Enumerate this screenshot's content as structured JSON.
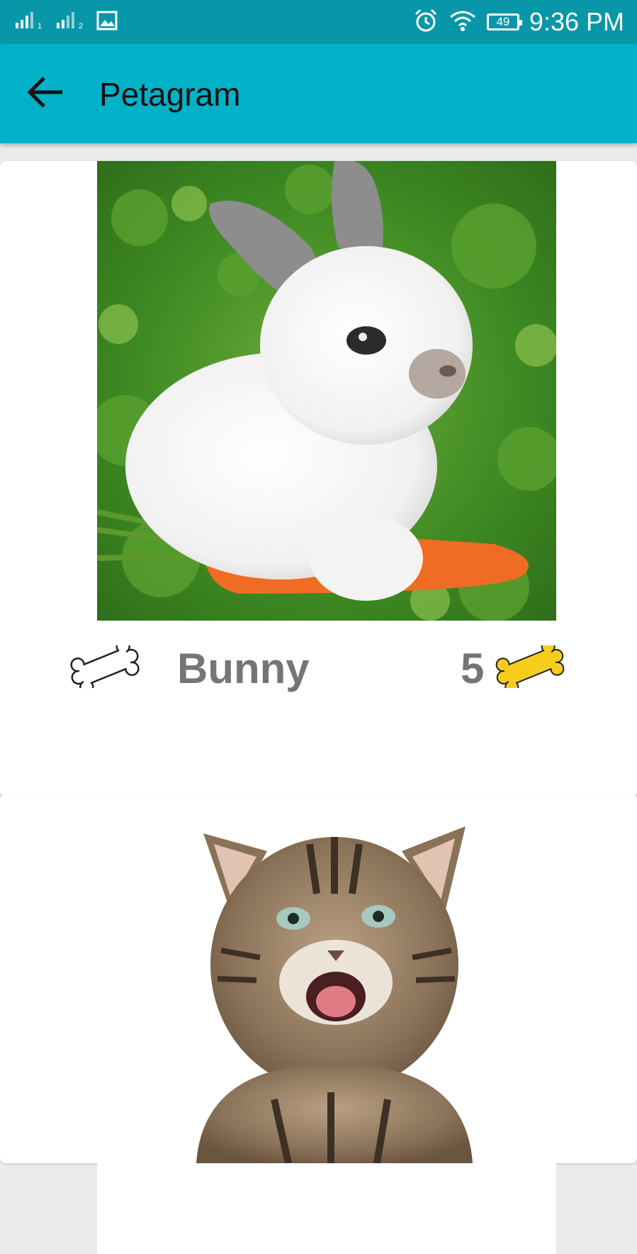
{
  "status_bar": {
    "sim1": "1",
    "sim2": "2",
    "battery": "49",
    "time": "9:36 PM"
  },
  "app_bar": {
    "title": "Petagram",
    "back_icon": "arrow-left-icon"
  },
  "pets": [
    {
      "name": "Bunny",
      "likes": "5",
      "photo": "white-bunny-with-carrot"
    },
    {
      "photo": "smiling-tabby-kitten"
    }
  ],
  "colors": {
    "status_bar": "#0797a8",
    "app_bar": "#00b1c8",
    "bone_filled": "#f6cd1c",
    "text_gray": "#757575"
  }
}
